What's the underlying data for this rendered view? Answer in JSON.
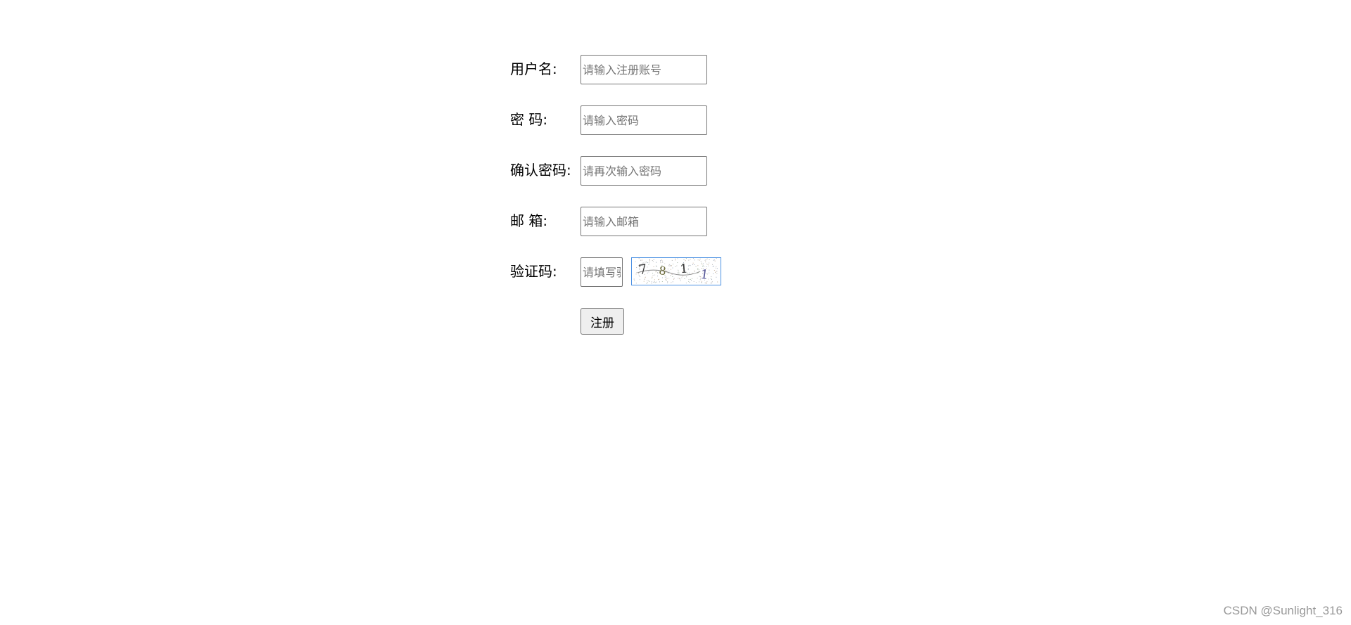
{
  "form": {
    "username": {
      "label": "用户名:",
      "placeholder": "请输入注册账号",
      "value": ""
    },
    "password": {
      "label": "密 码:",
      "placeholder": "请输入密码",
      "value": ""
    },
    "confirm_password": {
      "label": "确认密码:",
      "placeholder": "请再次输入密码",
      "value": ""
    },
    "email": {
      "label": "邮 箱:",
      "placeholder": "请输入邮箱",
      "value": ""
    },
    "captcha": {
      "label": "验证码:",
      "placeholder": "请填写验证码",
      "value": "",
      "image_text": [
        "7",
        "8",
        "1",
        "1"
      ]
    },
    "submit_label": "注册"
  },
  "watermark": "CSDN @Sunlight_316",
  "colors": {
    "captcha_border": "#4a90e2",
    "input_border": "#767676",
    "button_bg": "#efefef"
  }
}
